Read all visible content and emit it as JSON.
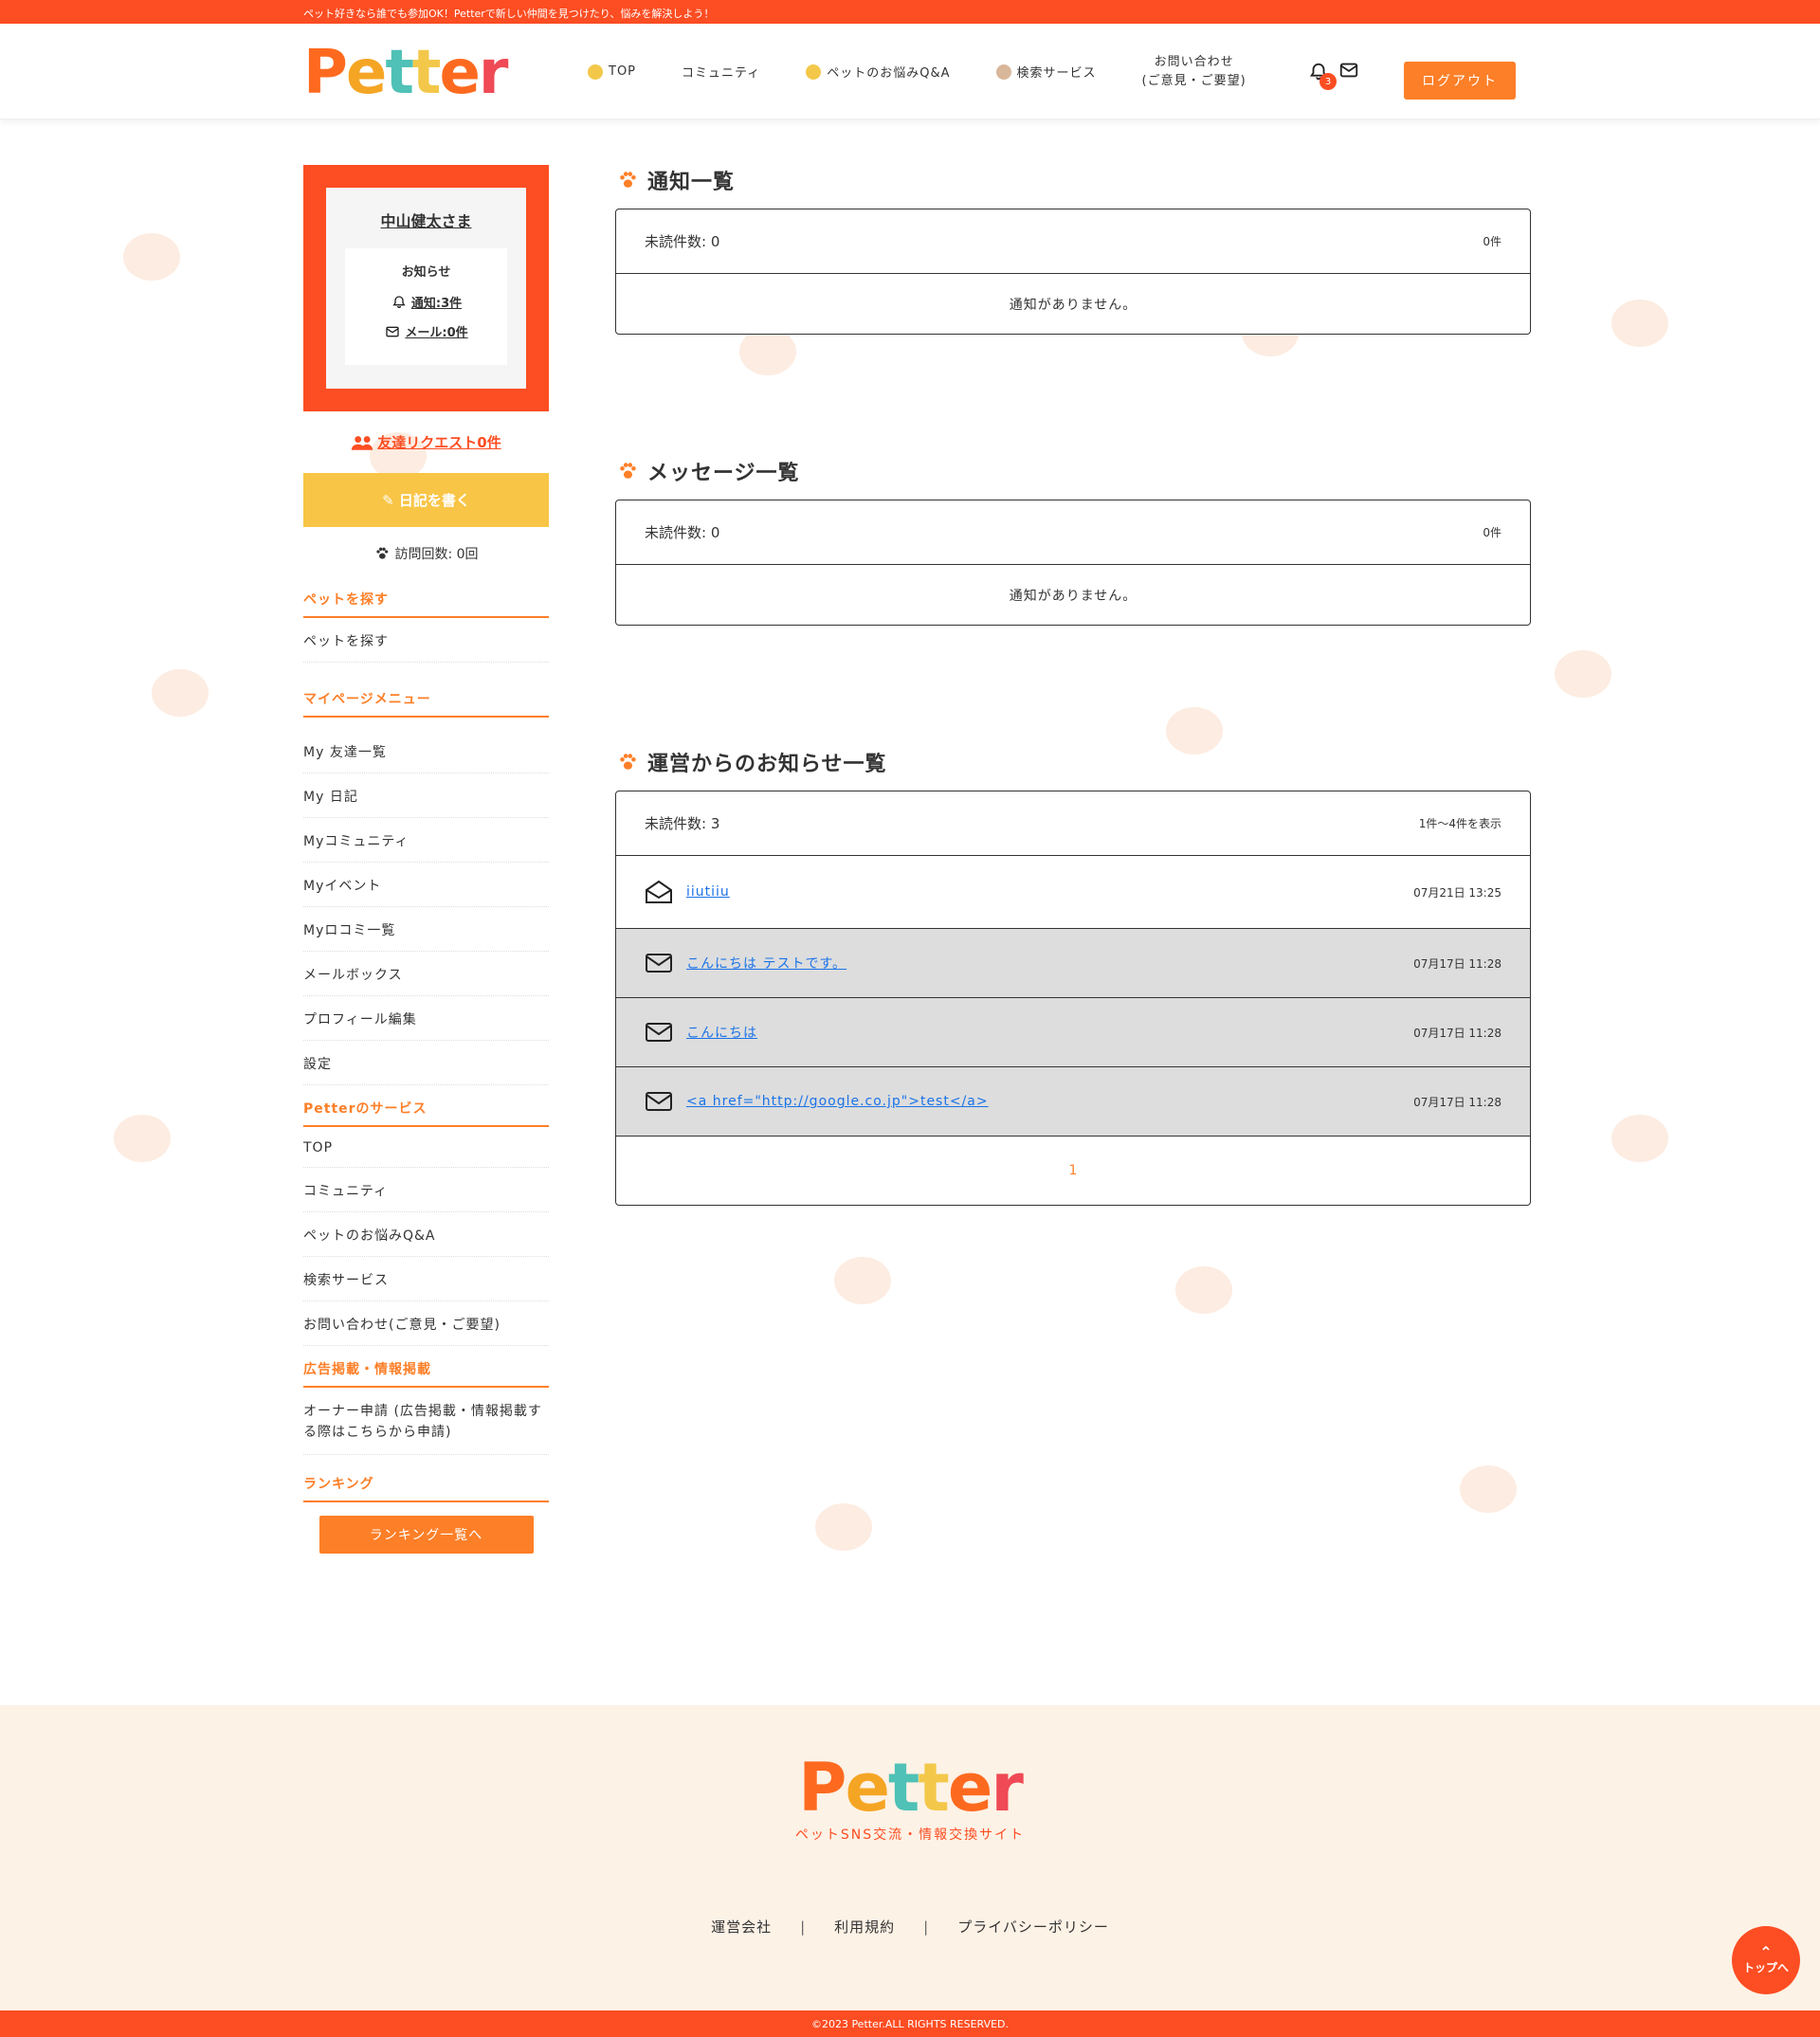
{
  "topbar": {
    "text": "ペット好きなら誰でも参加OK！Petterで新しい仲間を見つけたり、悩みを解決しよう！"
  },
  "header": {
    "logo": "Petter",
    "nav": [
      {
        "label": "TOP"
      },
      {
        "label": "コミュニティ"
      },
      {
        "label": "ペットのお悩みQ&A"
      },
      {
        "label": "検索サービス"
      },
      {
        "label": "お問い合わせ",
        "label2": "(ご意見・ご要望)"
      }
    ],
    "notification_count": "3",
    "logout_label": "ログアウト"
  },
  "sidebar": {
    "user_name": "中山健太さま",
    "notice_title": "お知らせ",
    "notice_link": "通知:3件",
    "mail_link": "メール:0件",
    "friend_request": "友達リクエスト0件",
    "diary_button": "日記を書く",
    "visits": "訪問回数: 0回",
    "sections": [
      {
        "heading": "ペットを探す",
        "items": [
          "ペットを探す"
        ]
      },
      {
        "heading": "マイページメニュー",
        "items": [
          "My 友達一覧",
          "My 日記",
          "Myコミュニティ",
          "Myイベント",
          "Myロコミ一覧",
          "メールボックス",
          "プロフィール編集",
          "設定"
        ]
      },
      {
        "heading": "Petterのサービス",
        "items": [
          "TOP",
          "コミュニティ",
          "ペットのお悩みQ&A",
          "検索サービス",
          "お問い合わせ(ご意見・ご要望)"
        ]
      },
      {
        "heading": "広告掲載・情報掲載",
        "items": [
          "オーナー申請 (広告掲載・情報掲載する際はこちらから申請)"
        ]
      },
      {
        "heading": "ランキング",
        "items": []
      }
    ],
    "ranking_button": "ランキング一覧へ"
  },
  "notifications": {
    "title": "通知一覧",
    "unread": "未読件数: 0",
    "count": "0件",
    "empty": "通知がありません。"
  },
  "messages": {
    "title": "メッセージ一覧",
    "unread": "未読件数: 0",
    "count": "0件",
    "empty": "通知がありません。"
  },
  "announcements": {
    "title": "運営からのお知らせ一覧",
    "unread": "未読件数: 3",
    "range": "1件～4件を表示",
    "rows": [
      {
        "subject": "iiutiiu",
        "date": "07月21日 13:25",
        "read": true
      },
      {
        "subject": "こんにちは テストです。",
        "date": "07月17日 11:28",
        "read": false
      },
      {
        "subject": "こんにちは",
        "date": "07月17日 11:28",
        "read": false
      },
      {
        "subject": "<a href=\"http://google.co.jp\">test</a>",
        "date": "07月17日 11:28",
        "read": false
      }
    ],
    "page": "1"
  },
  "footer": {
    "logo": "Petter",
    "subtitle": "ペットSNS交流・情報交換サイト",
    "links": [
      "運営会社",
      "利用規約",
      "プライバシーポリシー"
    ],
    "copyright": "©2023 Petter.ALL RIGHTS RESERVED.",
    "totop": "トップへ"
  },
  "colors": {
    "brand": "#fd4d22",
    "accent": "#fd7f28",
    "yellow": "#f8c546"
  }
}
